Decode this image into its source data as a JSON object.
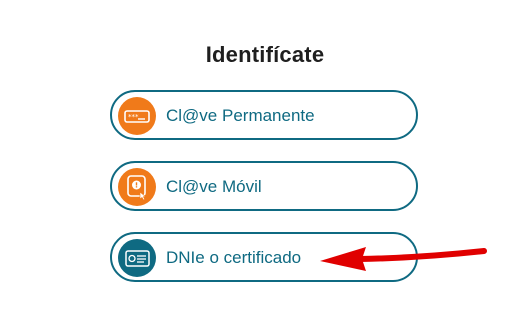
{
  "page": {
    "title": "Identifícate"
  },
  "options": [
    {
      "label": "Cl@ve Permanente",
      "icon": "password-card-icon",
      "icon_color": "#f07a1a"
    },
    {
      "label": "Cl@ve Móvil",
      "icon": "mobile-notification-icon",
      "icon_color": "#f07a1a"
    },
    {
      "label": "DNIe o certificado",
      "icon": "certificate-card-icon",
      "icon_color": "#0f6a82"
    }
  ],
  "colors": {
    "accent": "#0f6a82",
    "orange": "#f07a1a",
    "annotation_arrow": "#e00000"
  }
}
